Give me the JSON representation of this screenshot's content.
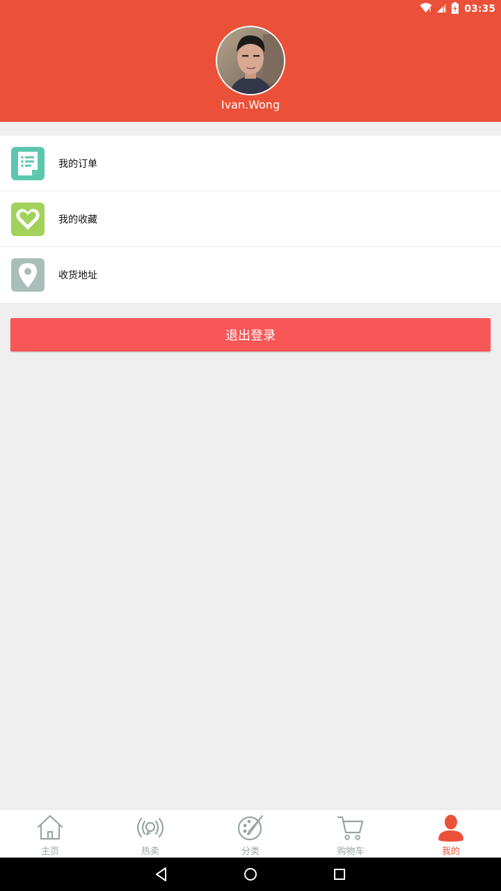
{
  "status_bar": {
    "time": "03:35",
    "icons": [
      "wifi-icon",
      "signal-icon",
      "battery-charging-icon"
    ]
  },
  "profile": {
    "username": "Ivan.Wong",
    "avatar_icon": "avatar-photo"
  },
  "menu": {
    "items": [
      {
        "label": "我的订单",
        "icon": "order-list-icon",
        "color": "#5cc7af"
      },
      {
        "label": "我的收藏",
        "icon": "heart-icon",
        "color": "#a2d25a"
      },
      {
        "label": "收货地址",
        "icon": "location-pin-icon",
        "color": "#a9bdb9"
      }
    ]
  },
  "logout": {
    "label": "退出登录",
    "color": "#f85657"
  },
  "tabbar": {
    "tabs": [
      {
        "label": "主页",
        "icon": "home-icon"
      },
      {
        "label": "热卖",
        "icon": "broadcast-icon"
      },
      {
        "label": "分类",
        "icon": "palette-icon"
      },
      {
        "label": "购物车",
        "icon": "cart-icon"
      },
      {
        "label": "我的",
        "icon": "user-icon",
        "active": true
      }
    ]
  },
  "colors": {
    "header": "#eb5138",
    "background": "#efefef",
    "tab_inactive": "#9aa5a3",
    "tab_active": "#eb5138"
  },
  "system_nav": [
    "back-icon",
    "home-circle-icon",
    "recents-icon"
  ]
}
